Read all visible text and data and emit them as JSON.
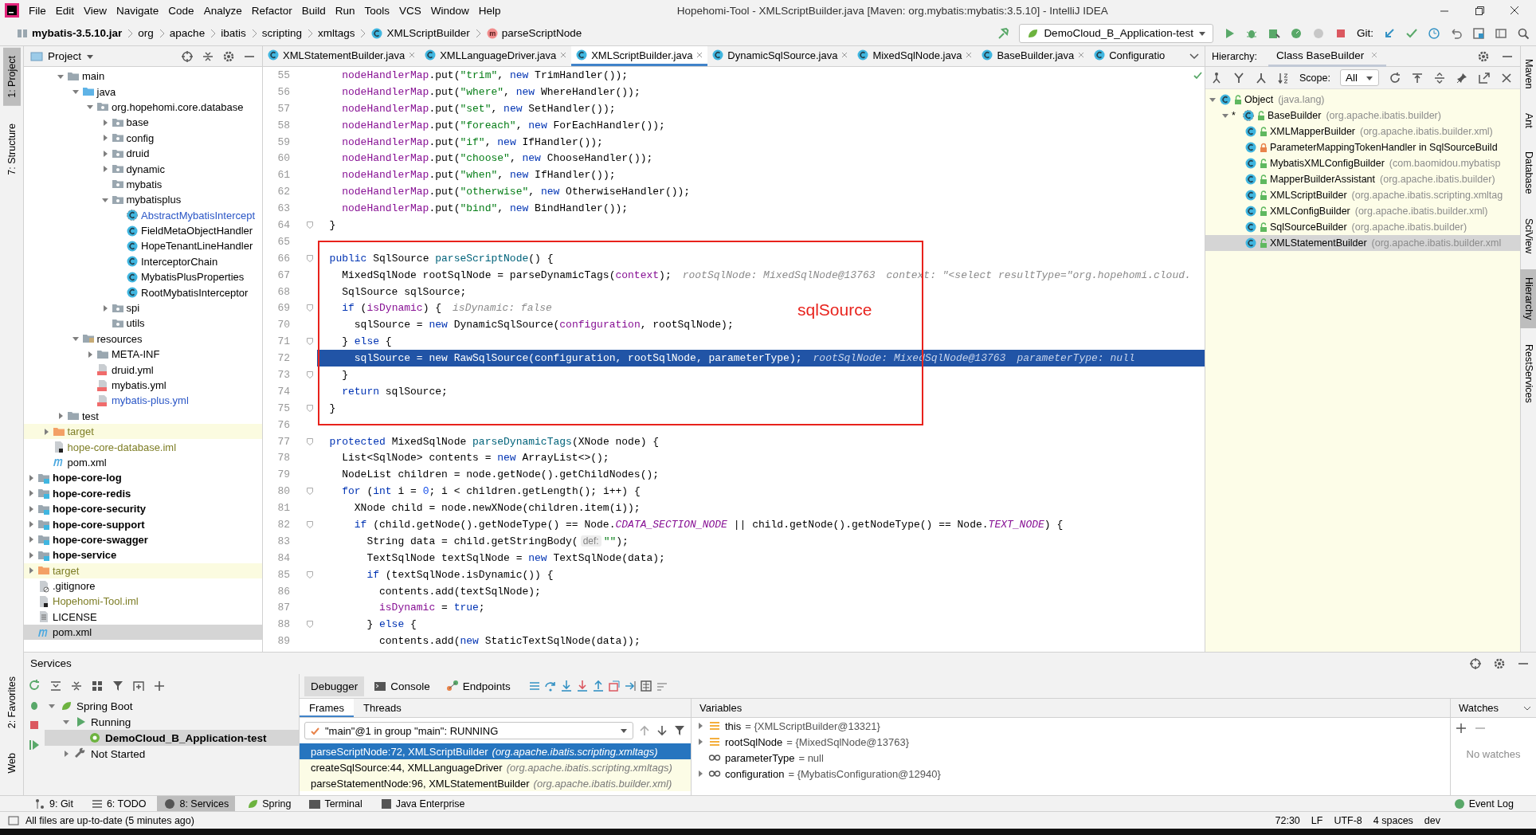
{
  "window": {
    "title": "Hopehomi-Tool - XMLScriptBuilder.java [Maven: org.mybatis:mybatis:3.5.10] - IntelliJ IDEA"
  },
  "menu": [
    "File",
    "Edit",
    "View",
    "Navigate",
    "Code",
    "Analyze",
    "Refactor",
    "Build",
    "Run",
    "Tools",
    "VCS",
    "Window",
    "Help"
  ],
  "breadcrumbs": [
    {
      "label": "mybatis-3.5.10.jar",
      "kind": "jar"
    },
    {
      "label": "org",
      "kind": "package"
    },
    {
      "label": "apache",
      "kind": "package"
    },
    {
      "label": "ibatis",
      "kind": "package"
    },
    {
      "label": "scripting",
      "kind": "package"
    },
    {
      "label": "xmltags",
      "kind": "package"
    },
    {
      "label": "XMLScriptBuilder",
      "kind": "class"
    },
    {
      "label": "parseScriptNode",
      "kind": "method"
    }
  ],
  "run_config": {
    "label": "DemoCloud_B_Application-test"
  },
  "vcs": {
    "label": "Git:"
  },
  "left_strip": {
    "top": [
      {
        "label": "1: Project",
        "selected": true
      },
      {
        "label": "7: Structure",
        "selected": false
      }
    ],
    "bottom": [
      {
        "label": "2: Favorites",
        "selected": false
      },
      {
        "label": "Web",
        "selected": false
      }
    ]
  },
  "project": {
    "title": "Project",
    "tree": [
      {
        "children": [
          {
            "children": [
              {
                "label": "main",
                "kind": "folder",
                "expanded": true,
                "selected": false,
                "children": [
                  {
                    "label": "java",
                    "kind": "source-root",
                    "expanded": true,
                    "selected": false,
                    "children": [
                      {
                        "label": "org.hopehomi.core.database",
                        "kind": "package",
                        "expanded": true,
                        "selected": false,
                        "children": [
                          {
                            "label": "base",
                            "kind": "package",
                            "expanded": false,
                            "selected": false
                          },
                          {
                            "label": "config",
                            "kind": "package",
                            "expanded": false,
                            "selected": false
                          },
                          {
                            "label": "druid",
                            "kind": "package",
                            "expanded": false,
                            "selected": false
                          },
                          {
                            "label": "dynamic",
                            "kind": "package",
                            "expanded": false,
                            "selected": false
                          },
                          {
                            "label": "mybatis",
                            "kind": "package",
                            "selected": false
                          },
                          {
                            "label": "mybatisplus",
                            "kind": "package",
                            "expanded": true,
                            "selected": false,
                            "children": [
                              {
                                "label": "AbstractMybatisIntercept",
                                "kind": "abstract-class",
                                "color": "#2a56c6",
                                "selected": false
                              },
                              {
                                "label": "FieldMetaObjectHandler",
                                "kind": "class",
                                "selected": false
                              },
                              {
                                "label": "HopeTenantLineHandler",
                                "kind": "class",
                                "selected": false
                              },
                              {
                                "label": "InterceptorChain",
                                "kind": "class",
                                "selected": false
                              },
                              {
                                "label": "MybatisPlusProperties",
                                "kind": "class",
                                "selected": false
                              },
                              {
                                "label": "RootMybatisInterceptor",
                                "kind": "class",
                                "selected": false
                              }
                            ]
                          },
                          {
                            "label": "spi",
                            "kind": "package",
                            "expanded": false,
                            "selected": false
                          },
                          {
                            "label": "utils",
                            "kind": "package",
                            "selected": false
                          }
                        ]
                      }
                    ]
                  },
                  {
                    "label": "resources",
                    "kind": "resources-root",
                    "expanded": true,
                    "selected": false,
                    "children": [
                      {
                        "label": "META-INF",
                        "kind": "folder",
                        "expanded": false,
                        "selected": false
                      },
                      {
                        "label": "druid.yml",
                        "kind": "yml",
                        "selected": false
                      },
                      {
                        "label": "mybatis.yml",
                        "kind": "yml",
                        "selected": false
                      },
                      {
                        "label": "mybatis-plus.yml",
                        "kind": "yml",
                        "color": "#2a56c6",
                        "selected": false
                      }
                    ]
                  }
                ]
              },
              {
                "label": "test",
                "kind": "folder",
                "expanded": false,
                "selected": false
              }
            ]
          },
          {
            "label": "target",
            "kind": "excluded",
            "expanded": false,
            "color": "#7d7d25",
            "selected": false
          },
          {
            "label": "hope-core-database.iml",
            "kind": "iml",
            "color": "#7d7d25",
            "selected": false
          },
          {
            "label": "pom.xml",
            "kind": "maven",
            "selected": false
          }
        ]
      },
      {
        "label": "hope-core-log",
        "kind": "module",
        "expanded": false,
        "selected": false
      },
      {
        "label": "hope-core-redis",
        "kind": "module",
        "expanded": false,
        "selected": false
      },
      {
        "label": "hope-core-security",
        "kind": "module",
        "expanded": false,
        "selected": false
      },
      {
        "label": "hope-core-support",
        "kind": "module",
        "expanded": false,
        "selected": false
      },
      {
        "label": "hope-core-swagger",
        "kind": "module",
        "expanded": false,
        "selected": false
      },
      {
        "label": "hope-service",
        "kind": "module",
        "expanded": false,
        "selected": false
      },
      {
        "label": "target",
        "kind": "excluded",
        "expanded": false,
        "color": "#7d7d25",
        "selected": false
      },
      {
        "label": ".gitignore",
        "kind": "gitignore",
        "selected": false
      },
      {
        "label": "Hopehomi-Tool.iml",
        "kind": "iml",
        "color": "#7d7d25",
        "selected": false
      },
      {
        "label": "LICENSE",
        "kind": "text",
        "selected": false
      },
      {
        "label": "pom.xml",
        "kind": "maven",
        "selected": true
      }
    ]
  },
  "editor": {
    "tabs": [
      {
        "label": "XMLStatementBuilder.java",
        "selected": false,
        "closable": true
      },
      {
        "label": "XMLLanguageDriver.java",
        "selected": false,
        "closable": true
      },
      {
        "label": "XMLScriptBuilder.java",
        "selected": true,
        "closable": true
      },
      {
        "label": "DynamicSqlSource.java",
        "selected": false,
        "closable": true
      },
      {
        "label": "MixedSqlNode.java",
        "selected": false,
        "closable": true
      },
      {
        "label": "BaseBuilder.java",
        "selected": false,
        "closable": true
      },
      {
        "label": "Configuratio",
        "selected": false,
        "closable": false
      }
    ],
    "lines": [
      {
        "number": "55",
        "current": false,
        "fold": false,
        "tokens": [
          {
            "kind": "fld",
            "text": "    nodeHandlerMap"
          },
          {
            "kind": "p",
            "text": ".put("
          },
          {
            "kind": "str",
            "text": "\"trim\""
          },
          {
            "kind": "p",
            "text": ", "
          },
          {
            "kind": "kw",
            "text": "new"
          },
          {
            "kind": "p",
            "text": " TrimHandler());"
          }
        ]
      },
      {
        "number": "56",
        "current": false,
        "fold": false,
        "tokens": [
          {
            "kind": "fld",
            "text": "    nodeHandlerMap"
          },
          {
            "kind": "p",
            "text": ".put("
          },
          {
            "kind": "str",
            "text": "\"where\""
          },
          {
            "kind": "p",
            "text": ", "
          },
          {
            "kind": "kw",
            "text": "new"
          },
          {
            "kind": "p",
            "text": " WhereHandler());"
          }
        ]
      },
      {
        "number": "57",
        "current": false,
        "fold": false,
        "tokens": [
          {
            "kind": "fld",
            "text": "    nodeHandlerMap"
          },
          {
            "kind": "p",
            "text": ".put("
          },
          {
            "kind": "str",
            "text": "\"set\""
          },
          {
            "kind": "p",
            "text": ", "
          },
          {
            "kind": "kw",
            "text": "new"
          },
          {
            "kind": "p",
            "text": " SetHandler());"
          }
        ]
      },
      {
        "number": "58",
        "current": false,
        "fold": false,
        "tokens": [
          {
            "kind": "fld",
            "text": "    nodeHandlerMap"
          },
          {
            "kind": "p",
            "text": ".put("
          },
          {
            "kind": "str",
            "text": "\"foreach\""
          },
          {
            "kind": "p",
            "text": ", "
          },
          {
            "kind": "kw",
            "text": "new"
          },
          {
            "kind": "p",
            "text": " ForEachHandler());"
          }
        ]
      },
      {
        "number": "59",
        "current": false,
        "fold": false,
        "tokens": [
          {
            "kind": "fld",
            "text": "    nodeHandlerMap"
          },
          {
            "kind": "p",
            "text": ".put("
          },
          {
            "kind": "str",
            "text": "\"if\""
          },
          {
            "kind": "p",
            "text": ", "
          },
          {
            "kind": "kw",
            "text": "new"
          },
          {
            "kind": "p",
            "text": " IfHandler());"
          }
        ]
      },
      {
        "number": "60",
        "current": false,
        "fold": false,
        "tokens": [
          {
            "kind": "fld",
            "text": "    nodeHandlerMap"
          },
          {
            "kind": "p",
            "text": ".put("
          },
          {
            "kind": "str",
            "text": "\"choose\""
          },
          {
            "kind": "p",
            "text": ", "
          },
          {
            "kind": "kw",
            "text": "new"
          },
          {
            "kind": "p",
            "text": " ChooseHandler());"
          }
        ]
      },
      {
        "number": "61",
        "current": false,
        "fold": false,
        "tokens": [
          {
            "kind": "fld",
            "text": "    nodeHandlerMap"
          },
          {
            "kind": "p",
            "text": ".put("
          },
          {
            "kind": "str",
            "text": "\"when\""
          },
          {
            "kind": "p",
            "text": ", "
          },
          {
            "kind": "kw",
            "text": "new"
          },
          {
            "kind": "p",
            "text": " IfHandler());"
          }
        ]
      },
      {
        "number": "62",
        "current": false,
        "fold": false,
        "tokens": [
          {
            "kind": "fld",
            "text": "    nodeHandlerMap"
          },
          {
            "kind": "p",
            "text": ".put("
          },
          {
            "kind": "str",
            "text": "\"otherwise\""
          },
          {
            "kind": "p",
            "text": ", "
          },
          {
            "kind": "kw",
            "text": "new"
          },
          {
            "kind": "p",
            "text": " OtherwiseHandler());"
          }
        ]
      },
      {
        "number": "63",
        "current": false,
        "fold": false,
        "tokens": [
          {
            "kind": "fld",
            "text": "    nodeHandlerMap"
          },
          {
            "kind": "p",
            "text": ".put("
          },
          {
            "kind": "str",
            "text": "\"bind\""
          },
          {
            "kind": "p",
            "text": ", "
          },
          {
            "kind": "kw",
            "text": "new"
          },
          {
            "kind": "p",
            "text": " BindHandler());"
          }
        ]
      },
      {
        "number": "64",
        "current": false,
        "fold": true,
        "tokens": [
          {
            "kind": "p",
            "text": "  }"
          }
        ]
      },
      {
        "number": "65",
        "current": false,
        "fold": false
      },
      {
        "number": "66",
        "current": false,
        "fold": true,
        "tokens": [
          {
            "kind": "kw",
            "text": "  public"
          },
          {
            "kind": "p",
            "text": " SqlSource "
          },
          {
            "kind": "fn",
            "text": "parseScriptNode"
          },
          {
            "kind": "p",
            "text": "() {"
          }
        ]
      },
      {
        "number": "67",
        "current": false,
        "fold": false,
        "tokens": [
          {
            "kind": "p",
            "text": "    MixedSqlNode rootSqlNode = parseDynamicTags("
          },
          {
            "kind": "fld",
            "text": "context"
          },
          {
            "kind": "p",
            "text": ");"
          },
          {
            "kind": "hint",
            "text": "rootSqlNode: MixedSqlNode@13763"
          },
          {
            "kind": "hint",
            "text": "context: \"<select resultType=\"org.hopehomi.cloud."
          }
        ]
      },
      {
        "number": "68",
        "current": false,
        "fold": false,
        "tokens": [
          {
            "kind": "p",
            "text": "    SqlSource sqlSource;"
          }
        ]
      },
      {
        "number": "69",
        "current": false,
        "fold": true,
        "tokens": [
          {
            "kind": "kw",
            "text": "    if"
          },
          {
            "kind": "p",
            "text": " ("
          },
          {
            "kind": "fld",
            "text": "isDynamic"
          },
          {
            "kind": "p",
            "text": ") {"
          },
          {
            "kind": "hint",
            "text": "isDynamic: false"
          }
        ]
      },
      {
        "number": "70",
        "current": false,
        "fold": false,
        "tokens": [
          {
            "kind": "p",
            "text": "      sqlSource = "
          },
          {
            "kind": "kw",
            "text": "new"
          },
          {
            "kind": "p",
            "text": " DynamicSqlSource("
          },
          {
            "kind": "fld",
            "text": "configuration"
          },
          {
            "kind": "p",
            "text": ", rootSqlNode);"
          }
        ]
      },
      {
        "number": "71",
        "current": false,
        "fold": true,
        "tokens": [
          {
            "kind": "p",
            "text": "    } "
          },
          {
            "kind": "kw",
            "text": "else"
          },
          {
            "kind": "p",
            "text": " {"
          }
        ]
      },
      {
        "number": "72",
        "current": true,
        "fold": false,
        "tokens": [
          {
            "kind": "p",
            "text": "      sqlSource = "
          },
          {
            "kind": "kw",
            "text": "new"
          },
          {
            "kind": "p",
            "text": " RawSqlSource("
          },
          {
            "kind": "fld",
            "text": "configuration"
          },
          {
            "kind": "p",
            "text": ", rootSqlNode, parameterType);"
          },
          {
            "kind": "hint",
            "text": "rootSqlNode: MixedSqlNode@13763"
          },
          {
            "kind": "hint",
            "text": "parameterType: null"
          }
        ]
      },
      {
        "number": "73",
        "current": false,
        "fold": true,
        "tokens": [
          {
            "kind": "p",
            "text": "    }"
          }
        ]
      },
      {
        "number": "74",
        "current": false,
        "fold": false,
        "tokens": [
          {
            "kind": "kw",
            "text": "    return"
          },
          {
            "kind": "p",
            "text": " sqlSource;"
          }
        ]
      },
      {
        "number": "75",
        "current": false,
        "fold": true,
        "tokens": [
          {
            "kind": "p",
            "text": "  }"
          }
        ]
      },
      {
        "number": "76",
        "current": false,
        "fold": false
      },
      {
        "number": "77",
        "current": false,
        "fold": true,
        "tokens": [
          {
            "kind": "kw",
            "text": "  protected"
          },
          {
            "kind": "p",
            "text": " MixedSqlNode "
          },
          {
            "kind": "fn",
            "text": "parseDynamicTags"
          },
          {
            "kind": "p",
            "text": "(XNode node) {"
          }
        ]
      },
      {
        "number": "78",
        "current": false,
        "fold": false,
        "tokens": [
          {
            "kind": "p",
            "text": "    List<SqlNode> contents = "
          },
          {
            "kind": "kw",
            "text": "new"
          },
          {
            "kind": "p",
            "text": " ArrayList<>();"
          }
        ]
      },
      {
        "number": "79",
        "current": false,
        "fold": false,
        "tokens": [
          {
            "kind": "p",
            "text": "    NodeList children = node.getNode().getChildNodes();"
          }
        ]
      },
      {
        "number": "80",
        "current": false,
        "fold": true,
        "tokens": [
          {
            "kind": "kw",
            "text": "    for"
          },
          {
            "kind": "p",
            "text": " ("
          },
          {
            "kind": "kw",
            "text": "int"
          },
          {
            "kind": "p",
            "text": " i = "
          },
          {
            "kind": "num",
            "text": "0"
          },
          {
            "kind": "p",
            "text": "; i < children.getLength(); i++) {"
          }
        ]
      },
      {
        "number": "81",
        "current": false,
        "fold": false,
        "tokens": [
          {
            "kind": "p",
            "text": "      XNode child = node.newXNode(children.item(i));"
          }
        ]
      },
      {
        "number": "82",
        "current": false,
        "fold": true,
        "tokens": [
          {
            "kind": "kw",
            "text": "      if"
          },
          {
            "kind": "p",
            "text": " (child.getNode().getNodeType() == Node."
          },
          {
            "kind": "const",
            "text": "CDATA_SECTION_NODE"
          },
          {
            "kind": "p",
            "text": " || child.getNode().getNodeType() == Node."
          },
          {
            "kind": "const",
            "text": "TEXT_NODE"
          },
          {
            "kind": "p",
            "text": ") {"
          }
        ]
      },
      {
        "number": "83",
        "current": false,
        "fold": false,
        "tokens": [
          {
            "kind": "p",
            "text": "        String data = child.getStringBody("
          },
          {
            "kind": "param",
            "text": "def:"
          },
          {
            "kind": "str",
            "text": "\"\""
          },
          {
            "kind": "p",
            "text": ");"
          }
        ]
      },
      {
        "number": "84",
        "current": false,
        "fold": false,
        "tokens": [
          {
            "kind": "p",
            "text": "        TextSqlNode textSqlNode = "
          },
          {
            "kind": "kw",
            "text": "new"
          },
          {
            "kind": "p",
            "text": " TextSqlNode(data);"
          }
        ]
      },
      {
        "number": "85",
        "current": false,
        "fold": true,
        "tokens": [
          {
            "kind": "kw",
            "text": "        if"
          },
          {
            "kind": "p",
            "text": " (textSqlNode.isDynamic()) {"
          }
        ]
      },
      {
        "number": "86",
        "current": false,
        "fold": false,
        "tokens": [
          {
            "kind": "p",
            "text": "          contents.add(textSqlNode);"
          }
        ]
      },
      {
        "number": "87",
        "current": false,
        "fold": false,
        "tokens": [
          {
            "kind": "fld",
            "text": "          isDynamic"
          },
          {
            "kind": "p",
            "text": " = "
          },
          {
            "kind": "kw",
            "text": "true"
          },
          {
            "kind": "p",
            "text": ";"
          }
        ]
      },
      {
        "number": "88",
        "current": false,
        "fold": true,
        "tokens": [
          {
            "kind": "p",
            "text": "        } "
          },
          {
            "kind": "kw",
            "text": "else"
          },
          {
            "kind": "p",
            "text": " {"
          }
        ]
      },
      {
        "number": "89",
        "current": false,
        "fold": false,
        "tokens": [
          {
            "kind": "p",
            "text": "          contents.add("
          },
          {
            "kind": "kw",
            "text": "new"
          },
          {
            "kind": "p",
            "text": " StaticTextSqlNode(data));"
          }
        ]
      }
    ],
    "annotation": {
      "text": "sqlSource"
    }
  },
  "hierarchy": {
    "label": "Hierarchy:",
    "tab": "Class BaseBuilder",
    "scope_label": "Scope:",
    "scope": "All",
    "tree": [
      {
        "name": "Object",
        "package": "(java.lang)",
        "kind": "class",
        "private": false,
        "selected": false,
        "expanded": true,
        "children": [
          {
            "marker": "*",
            "name": "BaseBuilder",
            "package": "(org.apache.ibatis.builder)",
            "kind": "abstract",
            "private": false,
            "selected": false,
            "expanded": true,
            "children": [
              {
                "name": "XMLMapperBuilder",
                "package": "(org.apache.ibatis.builder.xml)",
                "kind": "class",
                "private": false,
                "selected": false
              },
              {
                "name": "ParameterMappingTokenHandler in SqlSourceBuild",
                "kind": "class",
                "private": true,
                "selected": false
              },
              {
                "name": "MybatisXMLConfigBuilder",
                "package": "(com.baomidou.mybatisp",
                "kind": "class",
                "private": false,
                "selected": false
              },
              {
                "name": "MapperBuilderAssistant",
                "package": "(org.apache.ibatis.builder)",
                "kind": "class",
                "private": false,
                "selected": false
              },
              {
                "name": "XMLScriptBuilder",
                "package": "(org.apache.ibatis.scripting.xmltag",
                "kind": "class",
                "private": false,
                "selected": false
              },
              {
                "name": "XMLConfigBuilder",
                "package": "(org.apache.ibatis.builder.xml)",
                "kind": "class",
                "private": false,
                "selected": false
              },
              {
                "name": "SqlSourceBuilder",
                "package": "(org.apache.ibatis.builder)",
                "kind": "class",
                "private": false,
                "selected": false
              },
              {
                "name": "XMLStatementBuilder",
                "package": "(org.apache.ibatis.builder.xml",
                "kind": "class",
                "private": false,
                "selected": true
              }
            ]
          }
        ]
      }
    ]
  },
  "right_strip": [
    {
      "label": "Maven",
      "selected": false
    },
    {
      "label": "Ant",
      "selected": false
    },
    {
      "label": "Database",
      "selected": false
    },
    {
      "label": "SciView",
      "selected": false
    },
    {
      "label": "Hierarchy",
      "selected": true
    },
    {
      "label": "RestServices",
      "selected": false
    }
  ],
  "services": {
    "title": "Services",
    "tree": [
      {
        "label": "Spring Boot",
        "kind": "group",
        "expanded": true,
        "selected": false,
        "children": [
          {
            "label": "Running",
            "kind": "running",
            "expanded": true,
            "selected": false,
            "children": [
              {
                "label": "DemoCloud_B_Application-test",
                "kind": "app",
                "selected": true
              }
            ]
          },
          {
            "label": "Not Started",
            "kind": "stopped",
            "expanded": false,
            "selected": false
          }
        ]
      }
    ],
    "debugger_tabs": [
      {
        "label": "Debugger",
        "selected": true
      },
      {
        "label": "Console",
        "selected": false
      },
      {
        "label": "Endpoints",
        "selected": false
      }
    ],
    "frame_tabs": [
      {
        "label": "Frames",
        "selected": true
      },
      {
        "label": "Threads",
        "selected": false
      }
    ],
    "thread": "\"main\"@1 in group \"main\": RUNNING",
    "frames": [
      {
        "method": "parseScriptNode:72, XMLScriptBuilder",
        "package": "(org.apache.ibatis.scripting.xmltags)",
        "selected": true,
        "library": false
      },
      {
        "method": "createSqlSource:44, XMLLanguageDriver",
        "package": "(org.apache.ibatis.scripting.xmltags)",
        "selected": false,
        "library": true
      },
      {
        "method": "parseStatementNode:96, XMLStatementBuilder",
        "package": "(org.apache.ibatis.builder.xml)",
        "selected": false,
        "library": true
      }
    ],
    "variables_title": "Variables",
    "variables": [
      {
        "name": "this",
        "value": "= {XMLScriptBuilder@13321}",
        "kind": "field",
        "expanded": false
      },
      {
        "name": "rootSqlNode",
        "value": "= {MixedSqlNode@13763}",
        "kind": "field",
        "expanded": false
      },
      {
        "name": "parameterType",
        "value": "= null",
        "kind": "watch"
      },
      {
        "name": "configuration",
        "value": "= {MybatisConfiguration@12940}",
        "kind": "watch",
        "expanded": false
      }
    ],
    "watches": {
      "title": "Watches",
      "empty": "No watches"
    }
  },
  "tool_buttons": [
    {
      "label": "9: Git",
      "selected": false
    },
    {
      "label": "6: TODO",
      "selected": false
    },
    {
      "label": "8: Services",
      "selected": true
    },
    {
      "label": "Spring",
      "selected": false
    },
    {
      "label": "Terminal",
      "selected": false
    },
    {
      "label": "Java Enterprise",
      "selected": false
    }
  ],
  "event_log": "Event Log",
  "status_bar": {
    "message": "All files are up-to-date (5 minutes ago)",
    "items": [
      "72:30",
      "LF",
      "UTF-8",
      "4 spaces",
      "dev"
    ]
  }
}
